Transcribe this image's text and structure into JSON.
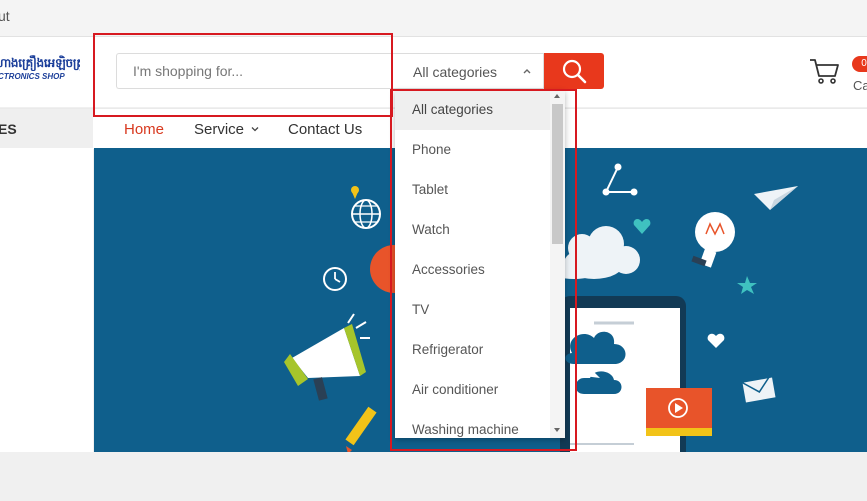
{
  "topbar": {
    "link": "ut"
  },
  "logo": {
    "khmer": "ហាងគ្រឿងអេឡិចត្រូនិច",
    "latin": "CTRONICS SHOP"
  },
  "search": {
    "placeholder": "I'm shopping for...",
    "value": ""
  },
  "category_select": {
    "selected": "All categories"
  },
  "cart": {
    "label": "Ca",
    "badge": "0"
  },
  "sidebar": {
    "heading": "ES"
  },
  "nav": {
    "home": "Home",
    "service": "Service",
    "contact": "Contact Us"
  },
  "dropdown": {
    "options": [
      {
        "label": "All categories"
      },
      {
        "label": "Phone"
      },
      {
        "label": "Tablet"
      },
      {
        "label": "Watch"
      },
      {
        "label": "Accessories"
      },
      {
        "label": "TV"
      },
      {
        "label": "Refrigerator"
      },
      {
        "label": "Air conditioner"
      },
      {
        "label": "Washing machine"
      }
    ]
  },
  "colors": {
    "accent": "#e8381c",
    "banner": "#0f5f8c",
    "highlight": "#d71920"
  }
}
